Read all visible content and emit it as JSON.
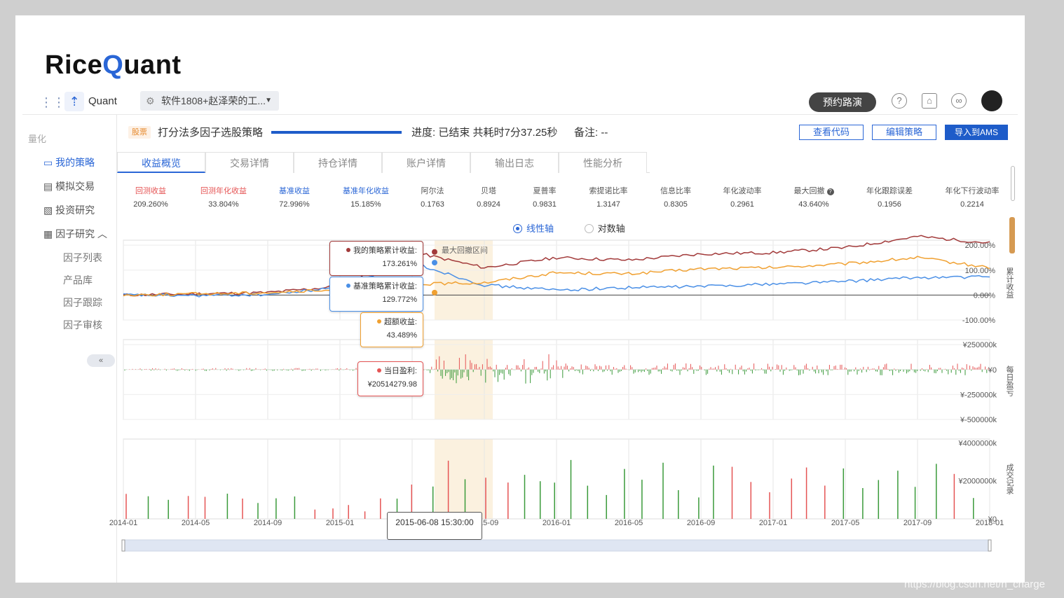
{
  "brand": {
    "logo_pre": "Rice",
    "logo_q": "Q",
    "logo_post": "uant",
    "product": "Quant"
  },
  "workspace": {
    "label": "软件1808+赵泽荣的工..."
  },
  "topbar": {
    "demo_button": "预约路演"
  },
  "sidebar": {
    "section": "量化",
    "items": [
      {
        "label": "我的策略",
        "active": true
      },
      {
        "label": "模拟交易",
        "active": false
      },
      {
        "label": "投资研究",
        "active": false
      },
      {
        "label": "因子研究",
        "active": false
      }
    ],
    "sub_items": [
      "因子列表",
      "产品库",
      "因子跟踪",
      "因子审核"
    ]
  },
  "strategy": {
    "tag": "股票",
    "name": "打分法多因子选股策略",
    "progress_text": "进度: 已结束 共耗时7分37.25秒",
    "note": "备注: --",
    "buttons": {
      "view_code": "查看代码",
      "edit": "编辑策略",
      "import": "导入到AMS"
    }
  },
  "tabs": [
    "收益概览",
    "交易详情",
    "持仓详情",
    "账户详情",
    "输出日志",
    "性能分析"
  ],
  "metrics": [
    {
      "label": "回测收益",
      "value": "209.260%",
      "color": "red"
    },
    {
      "label": "回测年化收益",
      "value": "33.804%",
      "color": "red"
    },
    {
      "label": "基准收益",
      "value": "72.996%",
      "color": "blue"
    },
    {
      "label": "基准年化收益",
      "value": "15.185%",
      "color": "blue"
    },
    {
      "label": "阿尔法",
      "value": "0.1763",
      "color": "dark"
    },
    {
      "label": "贝塔",
      "value": "0.8924",
      "color": "dark"
    },
    {
      "label": "夏普率",
      "value": "0.9831",
      "color": "dark"
    },
    {
      "label": "索提诺比率",
      "value": "1.3147",
      "color": "dark"
    },
    {
      "label": "信息比率",
      "value": "0.8305",
      "color": "dark"
    },
    {
      "label": "年化波动率",
      "value": "0.2961",
      "color": "dark"
    },
    {
      "label": "最大回撤",
      "value": "43.640%",
      "color": "dark"
    },
    {
      "label": "年化跟踪误差",
      "value": "0.1956",
      "color": "dark"
    },
    {
      "label": "年化下行波动率",
      "value": "0.2214",
      "color": "dark"
    }
  ],
  "axis_toggle": {
    "linear": "线性轴",
    "log": "对数轴"
  },
  "drawdown_label": "最大回撤区间",
  "tooltips": {
    "strategy": {
      "label": "我的策略累计收益:",
      "value": "173.261%"
    },
    "benchmark": {
      "label": "基准策略累计收益:",
      "value": "129.772%"
    },
    "excess": {
      "label": "超额收益:",
      "value": "43.489%"
    },
    "daily": {
      "label": "当日盈利:",
      "value": "¥20514279.98"
    },
    "date": "2015-06-08 15:30:00"
  },
  "colors": {
    "strategy": "#a23a3a",
    "benchmark": "#4a8fe6",
    "excess": "#f0a030",
    "up": "#e55454",
    "down": "#3a9a3a",
    "accent": "#2a66d6"
  },
  "chart_data": [
    {
      "type": "line",
      "title": "",
      "ylabel": "累计收益",
      "x_ticks": [
        "2014-01",
        "2014-05",
        "2014-09",
        "2015-01",
        "2015-05",
        "2015-09",
        "2016-01",
        "2016-05",
        "2016-09",
        "2017-01",
        "2017-05",
        "2017-09",
        "2018-01"
      ],
      "y_ticks": [
        "200.00%",
        "100.00%",
        "0.00%",
        "-100.00%"
      ],
      "ylim": [
        -100,
        220
      ],
      "series": [
        {
          "name": "我的策略累计收益",
          "values": [
            0,
            5,
            10,
            35,
            173,
            110,
            150,
            140,
            165,
            170,
            190,
            235,
            209
          ]
        },
        {
          "name": "基准策略累计收益",
          "values": [
            0,
            -2,
            2,
            30,
            130,
            40,
            20,
            30,
            35,
            45,
            55,
            70,
            73
          ]
        },
        {
          "name": "超额收益",
          "values": [
            0,
            5,
            10,
            20,
            43,
            50,
            90,
            85,
            105,
            110,
            125,
            150,
            110
          ]
        }
      ]
    },
    {
      "type": "bar",
      "title": "",
      "ylabel": "每日盈亏",
      "y_ticks": [
        "¥250000k",
        "¥0",
        "¥-250000k",
        "¥-500000k"
      ],
      "ylim": [
        -500000,
        300000
      ]
    },
    {
      "type": "bar",
      "title": "",
      "ylabel": "成交记录",
      "y_ticks": [
        "¥4000000k",
        "¥2000000k",
        "¥0"
      ],
      "ylim": [
        0,
        4200000
      ]
    }
  ],
  "watermark": "https://blog.csdn.net/h_charge"
}
